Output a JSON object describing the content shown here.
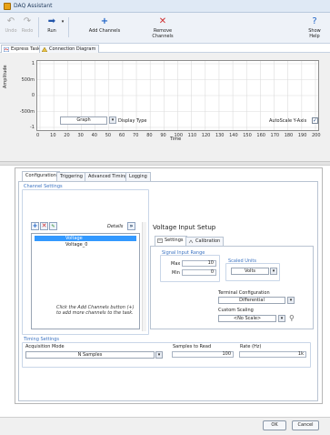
{
  "window": {
    "title": "DAQ Assistant"
  },
  "toolbar": {
    "undo": "Undo",
    "redo": "Redo",
    "run": "Run",
    "add_channels": "Add Channels",
    "remove_channels": "Remove Channels",
    "show_help": "Show Help"
  },
  "view_tabs": [
    "Express Task",
    "Connection Diagram"
  ],
  "graph": {
    "ylabel": "Amplitude",
    "xlabel": "Time",
    "yticks": [
      "1",
      "500m",
      "0",
      "-500m",
      "-1"
    ],
    "xticks": [
      "0",
      "10",
      "20",
      "30",
      "40",
      "50",
      "60",
      "70",
      "80",
      "90",
      "100",
      "110",
      "120",
      "130",
      "140",
      "150",
      "160",
      "170",
      "180",
      "190",
      "200"
    ],
    "graph_select": "Graph",
    "display_type": "Display Type",
    "autoscale": "AutoScale Y-Axis",
    "autoscale_checked": true
  },
  "config_tabs": [
    "Configuration",
    "Triggering",
    "Advanced Timing",
    "Logging"
  ],
  "channel_settings": {
    "title": "Channel Settings",
    "details": "Details",
    "channels": [
      "Voltage",
      "Voltage_0"
    ],
    "hint": "Click the Add Channels button (+) to add more channels to the task."
  },
  "voltage_setup": {
    "title": "Voltage Input Setup",
    "tabs": [
      "Settings",
      "Calibration"
    ],
    "signal_range_title": "Signal Input Range",
    "max_label": "Max",
    "max_value": "10",
    "min_label": "Min",
    "min_value": "0",
    "scaled_units_title": "Scaled Units",
    "scaled_units_value": "Volts",
    "terminal_config_label": "Terminal Configuration",
    "terminal_config_value": "Differential",
    "custom_scaling_label": "Custom Scaling",
    "custom_scaling_value": "<No Scale>"
  },
  "timing": {
    "title": "Timing Settings",
    "acq_mode_label": "Acquisition Mode",
    "acq_mode_value": "N Samples",
    "samples_label": "Samples to Read",
    "samples_value": "100",
    "rate_label": "Rate (Hz)",
    "rate_value": "1k"
  },
  "buttons": {
    "ok": "OK",
    "cancel": "Cancel"
  }
}
